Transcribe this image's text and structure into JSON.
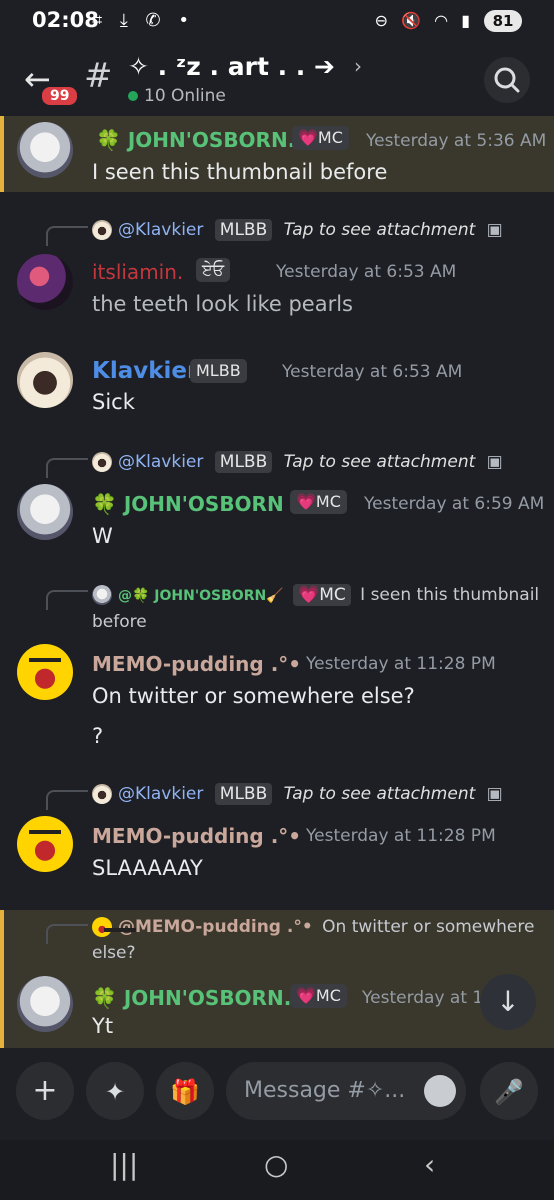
{
  "status": {
    "time": "02:08",
    "battery": "81"
  },
  "header": {
    "badge": "99",
    "channel": "✧ . ᶻz . art . . ➔",
    "online": "10 Online"
  },
  "messages": [
    {
      "id": "m1",
      "author": "🍀 JOHN'OSBORN...",
      "role": "💗MC",
      "time": "Yesterday at 5:36 AM",
      "text": "I seen this thumbnail before"
    },
    {
      "id": "m2",
      "reply_user": "@Klavkier",
      "reply_tag": "MLBB",
      "reply_text": "Tap to see attachment",
      "author": "itsliamin.",
      "role": "ਏਓ",
      "time": "Yesterday at 6:53 AM",
      "text": "the teeth look like pearls"
    },
    {
      "id": "m3",
      "author": "Klavkier",
      "role": "MLBB",
      "time": "Yesterday at 6:53 AM",
      "text": "Sick"
    },
    {
      "id": "m4",
      "reply_user": "@Klavkier",
      "reply_tag": "MLBB",
      "reply_text": "Tap to see attachment",
      "author": "🍀 JOHN'OSBORN ...",
      "role": "💗MC",
      "time": "Yesterday at 6:59 AM",
      "text": "W"
    },
    {
      "id": "m5",
      "reply_user": "@🍀 JOHN'OSBORN🧹",
      "reply_tag": "💗MC",
      "reply_text": "I seen this thumbnail before",
      "author": "MEMO-pudding .°•",
      "time": "Yesterday at 11:28 PM",
      "text": "On twitter or somewhere else?",
      "text2": "?"
    },
    {
      "id": "m6",
      "reply_user": "@Klavkier",
      "reply_tag": "MLBB",
      "reply_text": "Tap to see attachment",
      "author": "MEMO-pudding .°•",
      "time": "Yesterday at 11:28 PM",
      "text": "SLAAAAAY"
    },
    {
      "id": "m7",
      "reply_user": "@MEMO-pudding .°•",
      "reply_text": "On twitter or somewhere else?",
      "author": "🍀 JOHN'OSBORN...",
      "role": "💗MC",
      "time": "Yesterday at 11",
      "text": "Yt"
    }
  ],
  "composer": {
    "placeholder": "Message #✧..."
  },
  "icons": {
    "back": "arrow-left-icon",
    "search": "search-icon",
    "add": "plus-icon",
    "apps": "apps-icon",
    "gift": "gift-icon",
    "mic": "microphone-icon",
    "scroll": "arrow-down-icon"
  },
  "colors": {
    "john": "#57c278",
    "klav": "#4e8de6",
    "its": "#c4373d",
    "memo": "#c9a79a",
    "highlight": "#e5b33b"
  }
}
